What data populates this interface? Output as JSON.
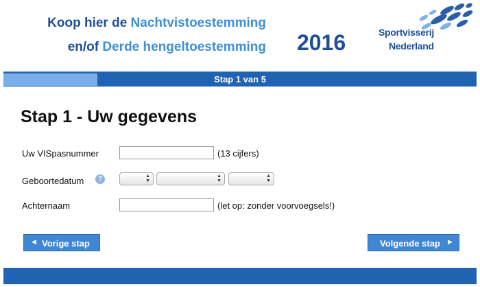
{
  "header": {
    "line1_prefix": "Koop hier de ",
    "line1_highlight": "Nachtvistoestemming",
    "line2_prefix": "en/of ",
    "line2_highlight": "Derde hengeltoestemming",
    "year": "2016",
    "logo_line1": "Sportvisserij",
    "logo_line2": "Nederland"
  },
  "progress": {
    "label": "Stap 1 van 5",
    "current_step": 1,
    "total_steps": 5
  },
  "form": {
    "title": "Stap 1 - Uw gegevens",
    "vispas": {
      "label": "Uw VISpasnummer",
      "value": "",
      "hint": "(13 cijfers)"
    },
    "birthdate": {
      "label": "Geboortedatum",
      "day": "",
      "month": "",
      "year": ""
    },
    "lastname": {
      "label": "Achternaam",
      "value": "",
      "hint": "(let op: zonder voorvoegsels!)"
    }
  },
  "buttons": {
    "prev": "Vorige stap",
    "next": "Volgende stap"
  },
  "colors": {
    "brand_dark": "#1e4f9a",
    "brand_light": "#3c8fd8",
    "bar": "#1f63b2",
    "button": "#3f86d3"
  },
  "icons": {
    "info": "question-icon",
    "prev_arrow": "triangle-left-icon",
    "next_arrow": "triangle-right-icon"
  }
}
